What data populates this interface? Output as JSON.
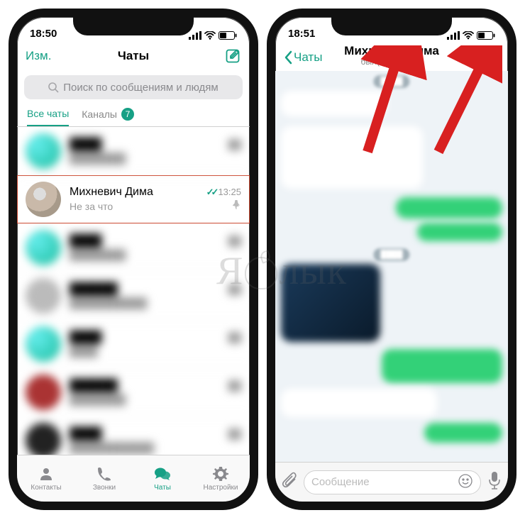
{
  "left": {
    "statusbar": {
      "time": "18:50"
    },
    "nav": {
      "edit": "Изм.",
      "title": "Чаты"
    },
    "search": {
      "placeholder": "Поиск по сообщениям и людям"
    },
    "filters": {
      "all": "Все чаты",
      "channels": "Каналы",
      "channels_badge": "7"
    },
    "highlighted_chat": {
      "name": "Михневич Дима",
      "preview": "Не за что",
      "time": "13:25"
    },
    "tabs": {
      "contacts": "Контакты",
      "calls": "Звонки",
      "chats": "Чаты",
      "settings": "Настройки"
    }
  },
  "right": {
    "statusbar": {
      "time": "18:51"
    },
    "nav": {
      "back": "Чаты",
      "title": "Михневич Дима",
      "subtitle": "был(а) недавно"
    },
    "composer": {
      "placeholder": "Сообщение"
    }
  },
  "watermark": {
    "a": "Я",
    "b": "лык"
  }
}
